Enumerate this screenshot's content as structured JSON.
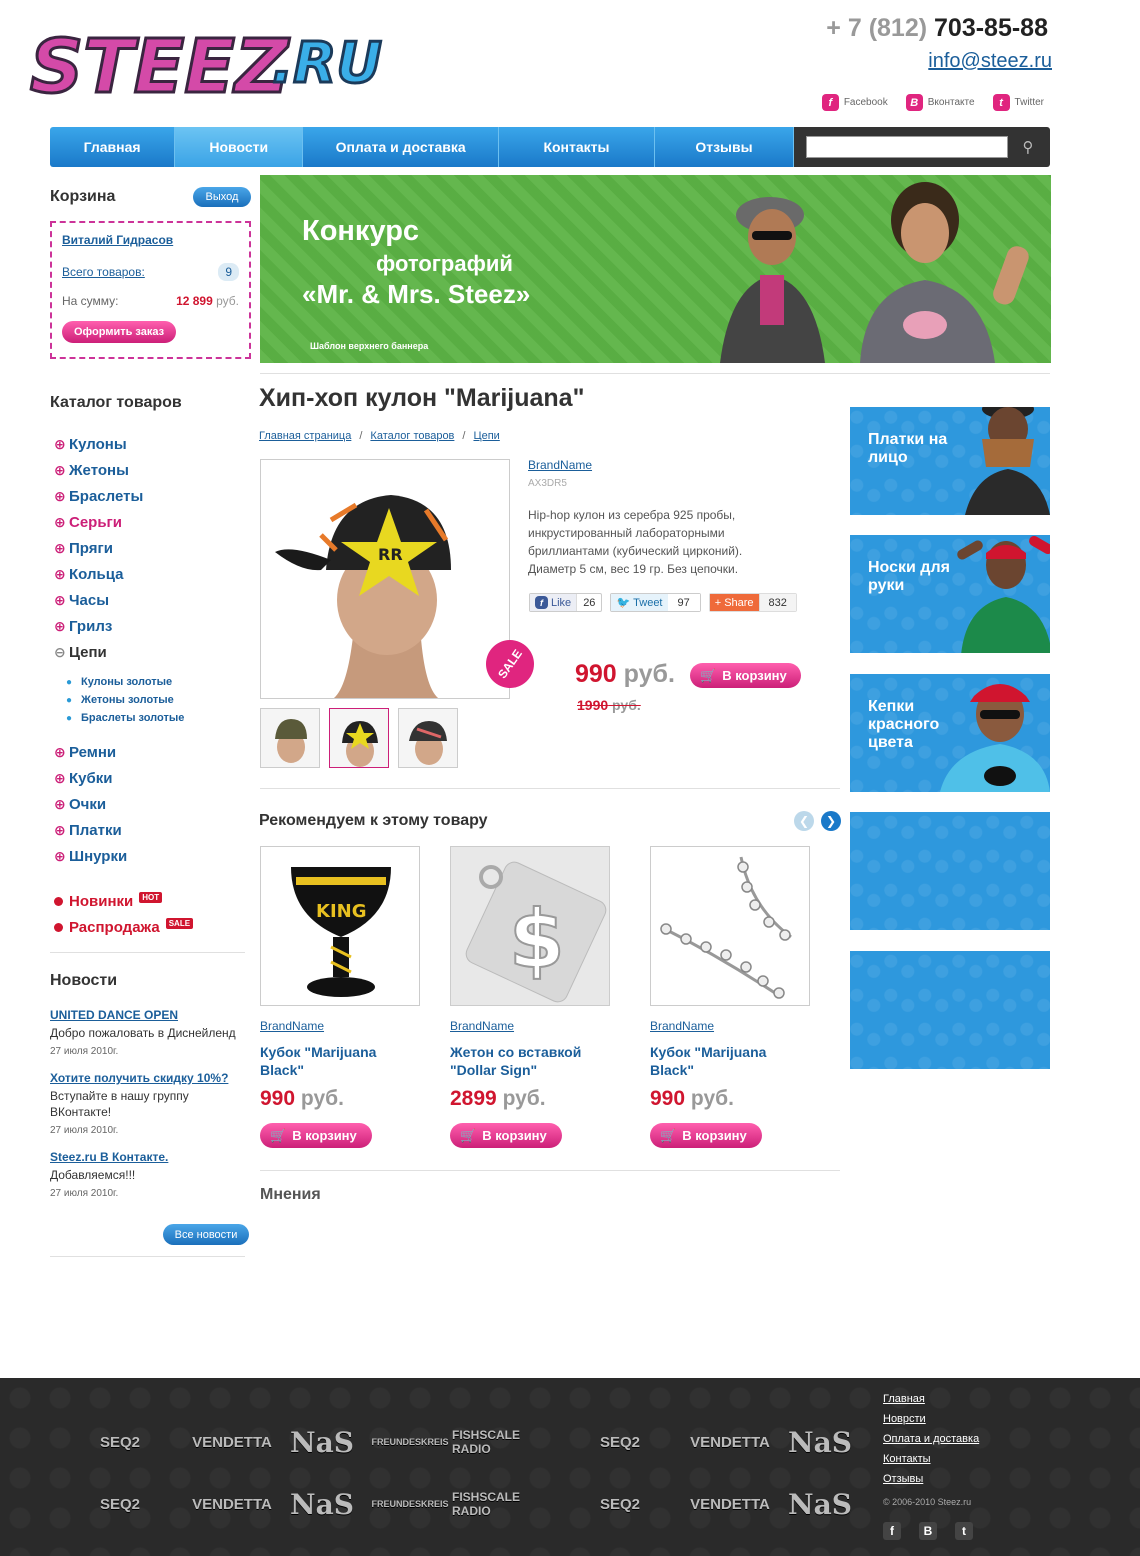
{
  "header": {
    "phone_prefix": "+ 7 (812)",
    "phone_number": "703-85-88",
    "email": "info@steez.ru",
    "social": [
      {
        "icon": "facebook-icon",
        "label": "Facebook"
      },
      {
        "icon": "vkontakte-icon",
        "label": "Вконтакте"
      },
      {
        "icon": "twitter-icon",
        "label": "Twitter"
      }
    ]
  },
  "nav": {
    "items": [
      "Главная",
      "Новости",
      "Оплата и доставка",
      "Контакты",
      "Отзывы"
    ],
    "active": "Новости",
    "search_placeholder": ""
  },
  "cart": {
    "title": "Корзина",
    "logout": "Выход",
    "user": "Виталий Гидрасов",
    "items_label": "Всего товаров:",
    "items_count": "9",
    "sum_label": "На сумму:",
    "sum_value": "12 899",
    "sum_currency": "руб.",
    "checkout": "Оформить заказ"
  },
  "catalog": {
    "title": "Каталог товаров",
    "items": [
      "Кулоны",
      "Жетоны",
      "Браслеты",
      "Серьги",
      "Пряги",
      "Кольца",
      "Часы",
      "Грилз",
      "Цепи"
    ],
    "sub_items": [
      "Кулоны золотые",
      "Жетоны золотые",
      "Браслеты золотые"
    ],
    "items_after": [
      "Ремни",
      "Кубки",
      "Очки",
      "Платки",
      "Шнурки"
    ],
    "new": "Новинки",
    "new_tag": "HOT",
    "sale": "Распродажа",
    "sale_tag": "SALE"
  },
  "news": {
    "title": "Новости",
    "items": [
      {
        "title": "UNITED DANCE OPEN",
        "text": "Добро пожаловать в Диснейленд",
        "date": "27 июля 2010г."
      },
      {
        "title": "Хотите получить скидку 10%?",
        "text": "Вступайте в нашу группу ВКонтакте!",
        "date": "27 июля 2010г."
      },
      {
        "title": "Steez.ru В Контакте.",
        "text": "Добавляемся!!!",
        "date": "27 июля 2010г."
      }
    ],
    "all": "Все новости"
  },
  "banner": {
    "line1": "Конкурс",
    "line2": "фотографий",
    "line3": "«Mr. & Mrs. Steez»",
    "caption": "Шаблон верхнего баннера"
  },
  "product": {
    "title": "Хип-хоп кулон \"Marijuana\"",
    "breadcrumb": [
      "Главная страница",
      "Каталог товаров",
      "Цепи"
    ],
    "brand": "BrandName",
    "sku": "AX3DR5",
    "description": "Hip-hop кулон из серебра 925 пробы, инкрустированный лабораторными бриллиантами (кубический цирконий). Диаметр 5 см, вес 19 гр. Без цепочки.",
    "sale_badge": "SALE",
    "price": "990",
    "old_price": "1990",
    "currency": "руб.",
    "cart_button": "В корзину",
    "share": {
      "like_label": "Like",
      "like_count": "26",
      "tweet_label": "Tweet",
      "tweet_count": "97",
      "share_label": "Share",
      "share_count": "832"
    }
  },
  "recommend": {
    "title": "Рекомендуем к этому товару",
    "items": [
      {
        "brand": "BrandName",
        "name": "Кубок \"Marijuana Black\"",
        "price": "990",
        "currency": "руб.",
        "button": "В корзину"
      },
      {
        "brand": "BrandName",
        "name": "Жетон со вставкой \"Dollar Sign\"",
        "price": "2899",
        "currency": "руб.",
        "button": "В корзину"
      },
      {
        "brand": "BrandName",
        "name": "Кубок \"Marijuana Black\"",
        "price": "990",
        "currency": "руб.",
        "button": "В корзину"
      }
    ]
  },
  "opinions_title": "Мнения",
  "side_banners": [
    {
      "text": "Платки на лицо"
    },
    {
      "text": "Носки для руки"
    },
    {
      "text": "Кепки красного цвета"
    },
    {
      "text": ""
    },
    {
      "text": ""
    }
  ],
  "footer": {
    "links": [
      "Главная",
      "Новрсти",
      "Оплата и доставка",
      "Контакты",
      "Отзывы"
    ],
    "copyright": "© 2006-2010 Steez.ru",
    "logos": [
      "SEQ2",
      "VENDETTA",
      "NaS",
      "FREUNDESKREIS",
      "FISHSCALE RADIO",
      "SEQ2",
      "VENDETTA",
      "NaS"
    ]
  },
  "colors": {
    "accent_blue": "#1a79c9",
    "accent_pink": "#cc1f78",
    "price_red": "#d0152f",
    "banner_green": "#5cb345",
    "side_blue": "#2e98dd",
    "footer_dark": "#2a2a2a"
  }
}
